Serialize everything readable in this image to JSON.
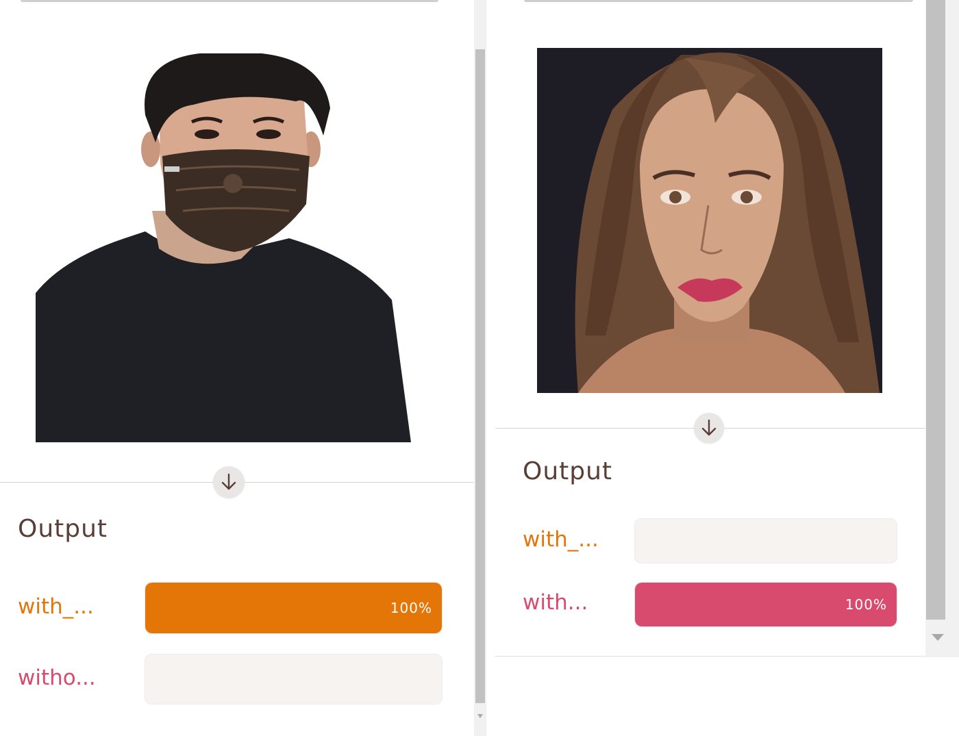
{
  "colors": {
    "orange": "#e47507",
    "pink": "#d84a6e",
    "title": "#5a3e36"
  },
  "left_panel": {
    "image_alt": "man wearing a patterned face mask",
    "output_heading": "Output",
    "results": [
      {
        "label": "with_...",
        "percent_text": "100%",
        "value": 1.0,
        "color": "orange"
      },
      {
        "label": "witho...",
        "percent_text": "",
        "value": 0.0,
        "color": "pink"
      }
    ]
  },
  "right_panel": {
    "image_alt": "woman without a face mask",
    "output_heading": "Output",
    "results": [
      {
        "label": "with_...",
        "percent_text": "",
        "value": 0.0,
        "color": "orange"
      },
      {
        "label": "with...",
        "percent_text": "100%",
        "value": 1.0,
        "color": "pink"
      }
    ]
  },
  "icons": {
    "arrow": "arrow-down-icon"
  }
}
